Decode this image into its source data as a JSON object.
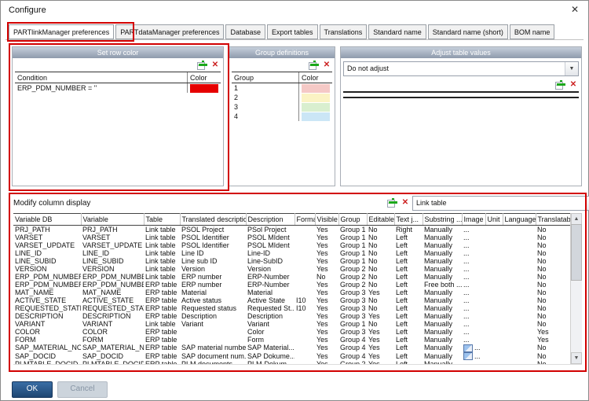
{
  "window": {
    "title": "Configure"
  },
  "glyphs": {
    "close": "✕",
    "delete": "✕",
    "dropdown_arrow": "▼",
    "scroll_up": "▲",
    "scroll_down": "▼"
  },
  "tabs": [
    {
      "label": "PARTlinkManager preferences",
      "selected": true
    },
    {
      "label": "PARTdataManager preferences",
      "selected": false
    },
    {
      "label": "Database",
      "selected": false
    },
    {
      "label": "Export tables",
      "selected": false
    },
    {
      "label": "Translations",
      "selected": false
    },
    {
      "label": "Standard name",
      "selected": false
    },
    {
      "label": "Standard name (short)",
      "selected": false
    },
    {
      "label": "BOM name",
      "selected": false
    }
  ],
  "set_row_color": {
    "title": "Set row color",
    "columns": [
      "Condition",
      "Color"
    ],
    "rows": [
      {
        "condition": "ERP_PDM_NUMBER = ''",
        "color": "#e60000"
      }
    ]
  },
  "group_definitions": {
    "title": "Group definitions",
    "columns": [
      "Group",
      "Color"
    ],
    "rows": [
      {
        "group": "1",
        "color": "#f5c9c6"
      },
      {
        "group": "2",
        "color": "#fbf3c4"
      },
      {
        "group": "3",
        "color": "#d9efcf"
      },
      {
        "group": "4",
        "color": "#cbe6f6"
      }
    ]
  },
  "adjust_table_values": {
    "title": "Adjust table values",
    "mode_value": "Do not adjust"
  },
  "modify": {
    "label": "Modify column display",
    "table_select_value": "Link table",
    "columns": [
      "Variable DB",
      "Variable",
      "Table",
      "Translated description",
      "Description",
      "Format",
      "Visible",
      "Group",
      "Editable",
      "Text j...",
      "Substring ...",
      "Image",
      "Unit",
      "Language",
      "Translatable"
    ],
    "rows": [
      {
        "cells": [
          "PRJ_PATH",
          "PRJ_PATH",
          "Link table",
          "PSOL Project",
          "PSol Project",
          "",
          "Yes",
          "Group 1",
          "No",
          "Right",
          "Manually",
          "...",
          "",
          "",
          "No"
        ],
        "image_icon": false
      },
      {
        "cells": [
          "VARSET",
          "VARSET",
          "Link table",
          "PSOL Identifier",
          "PSOL MIdent",
          "",
          "Yes",
          "Group 1",
          "No",
          "Left",
          "Manually",
          "...",
          "",
          "",
          "No"
        ],
        "image_icon": false
      },
      {
        "cells": [
          "VARSET_UPDATE",
          "VARSET_UPDATE",
          "Link table",
          "PSOL Identifier",
          "PSOL MIdent",
          "",
          "Yes",
          "Group 1",
          "No",
          "Left",
          "Manually",
          "...",
          "",
          "",
          "No"
        ],
        "image_icon": false
      },
      {
        "cells": [
          "LINE_ID",
          "LINE_ID",
          "Link table",
          "Line ID",
          "Line-ID",
          "",
          "Yes",
          "Group 1",
          "No",
          "Left",
          "Manually",
          "...",
          "",
          "",
          "No"
        ],
        "image_icon": false
      },
      {
        "cells": [
          "LINE_SUBID",
          "LINE_SUBID",
          "Link table",
          "Line sub ID",
          "Line-SubID",
          "",
          "Yes",
          "Group 1",
          "No",
          "Left",
          "Manually",
          "...",
          "",
          "",
          "No"
        ],
        "image_icon": false
      },
      {
        "cells": [
          "VERSION",
          "VERSION",
          "Link table",
          "Version",
          "Version",
          "",
          "Yes",
          "Group 2",
          "No",
          "Left",
          "Manually",
          "...",
          "",
          "",
          "No"
        ],
        "image_icon": false
      },
      {
        "cells": [
          "ERP_PDM_NUMBER",
          "ERP_PDM_NUMBE...",
          "Link table",
          "ERP number",
          "ERP-Number",
          "",
          "No",
          "Group 2",
          "No",
          "Left",
          "Manually",
          "...",
          "",
          "",
          "No"
        ],
        "image_icon": false
      },
      {
        "cells": [
          "ERP_PDM_NUMBER",
          "ERP_PDM_NUMBER",
          "ERP table",
          "ERP number",
          "ERP-Number",
          "",
          "Yes",
          "Group 2",
          "No",
          "Left",
          "Free both ...",
          "...",
          "",
          "",
          "No"
        ],
        "image_icon": false
      },
      {
        "cells": [
          "MAT_NAME",
          "MAT_NAME",
          "ERP table",
          "Material",
          "Material",
          "",
          "Yes",
          "Group 3",
          "Yes",
          "Left",
          "Manually",
          "...",
          "",
          "",
          "No"
        ],
        "image_icon": false
      },
      {
        "cells": [
          "ACTIVE_STATE",
          "ACTIVE_STATE",
          "ERP table",
          "Active status",
          "Active State",
          "I10",
          "Yes",
          "Group 3",
          "No",
          "Left",
          "Manually",
          "...",
          "",
          "",
          "No"
        ],
        "image_icon": false
      },
      {
        "cells": [
          "REQUESTED_STATE",
          "REQUESTED_STATE",
          "ERP table",
          "Requested status",
          "Requested St...",
          "I10",
          "Yes",
          "Group 3",
          "No",
          "Left",
          "Manually",
          "...",
          "",
          "",
          "No"
        ],
        "image_icon": false
      },
      {
        "cells": [
          "DESCRIPTION",
          "DESCRIPTION",
          "ERP table",
          "Description",
          "Description",
          "",
          "Yes",
          "Group 3",
          "Yes",
          "Left",
          "Manually",
          "...",
          "",
          "",
          "No"
        ],
        "image_icon": false
      },
      {
        "cells": [
          "VARIANT",
          "VARIANT",
          "Link table",
          "Variant",
          "Variant",
          "",
          "Yes",
          "Group 1",
          "No",
          "Left",
          "Manually",
          "...",
          "",
          "",
          "No"
        ],
        "image_icon": false
      },
      {
        "cells": [
          "COLOR",
          "COLOR",
          "ERP table",
          "",
          "Color",
          "",
          "Yes",
          "Group 3",
          "Yes",
          "Left",
          "Manually",
          "...",
          "",
          "",
          "Yes"
        ],
        "image_icon": false
      },
      {
        "cells": [
          "FORM",
          "FORM",
          "ERP table",
          "",
          "Form",
          "",
          "Yes",
          "Group 4",
          "Yes",
          "Left",
          "Manually",
          "...",
          "",
          "",
          "Yes"
        ],
        "image_icon": false
      },
      {
        "cells": [
          "SAP_MATERIAL_NO",
          "SAP_MATERIAL_NO",
          "ERP table",
          "SAP material number",
          "SAP Material...",
          "",
          "Yes",
          "Group 4",
          "Yes",
          "Left",
          "Manually",
          "...",
          "",
          "",
          "No"
        ],
        "image_icon": true
      },
      {
        "cells": [
          "SAP_DOCID",
          "SAP_DOCID",
          "ERP table",
          "SAP document num...",
          "SAP Dokume...",
          "",
          "Yes",
          "Group 4",
          "Yes",
          "Left",
          "Manually",
          "...",
          "",
          "",
          "No"
        ],
        "image_icon": true
      },
      {
        "cells": [
          "PLMTABLE_DOCID",
          "PLMTABLE_DOCID",
          "ERP table",
          "PLM documents",
          "PLM-Dokum...",
          "",
          "Yes",
          "Group 2",
          "Yes",
          "Left",
          "Manually",
          "...",
          "",
          "",
          "No"
        ],
        "image_icon": false
      }
    ]
  },
  "actions": {
    "ok": "OK",
    "cancel": "Cancel"
  }
}
